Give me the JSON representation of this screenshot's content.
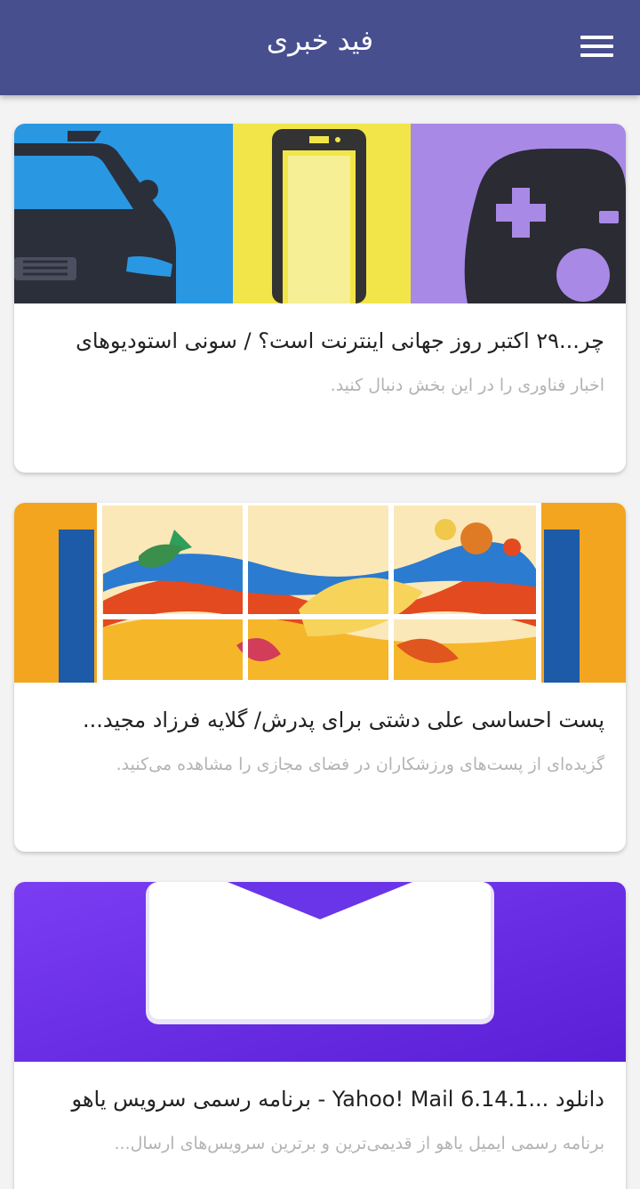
{
  "appbar": {
    "title": "فید خبری",
    "menu_icon": "hamburger-menu-icon"
  },
  "colors": {
    "appbar": "#474f8f",
    "background": "#f3f3f3",
    "card": "#ffffff",
    "headline": "#222222",
    "summary": "#b3b3b3"
  },
  "news": [
    {
      "headline": "چر...۲۹ اکتبر روز جهانی اینترنت است؟ / سونی استودیوهای",
      "summary": "اخبار فناوری را در این بخش دنبال کنید.",
      "image": "car-phone-gamepad-illustration"
    },
    {
      "headline": "پست احساسی علی دشتی برای پدرش/ گلایه فرزاد مجید...",
      "summary": "گزیده‌ای از پست‌های ورزشکاران در فضای مجازی را مشاهده می‌کنید.",
      "image": "colorful-mural-panels"
    },
    {
      "headline": "دانلود ...Yahoo! Mail 6.14.1 - برنامه رسمی سرویس یاهو",
      "summary": "برنامه رسمی ایمیل یاهو از قدیمی‌ترین و برترین سرویس‌های ارسال...",
      "image": "purple-mail-envelope"
    }
  ]
}
